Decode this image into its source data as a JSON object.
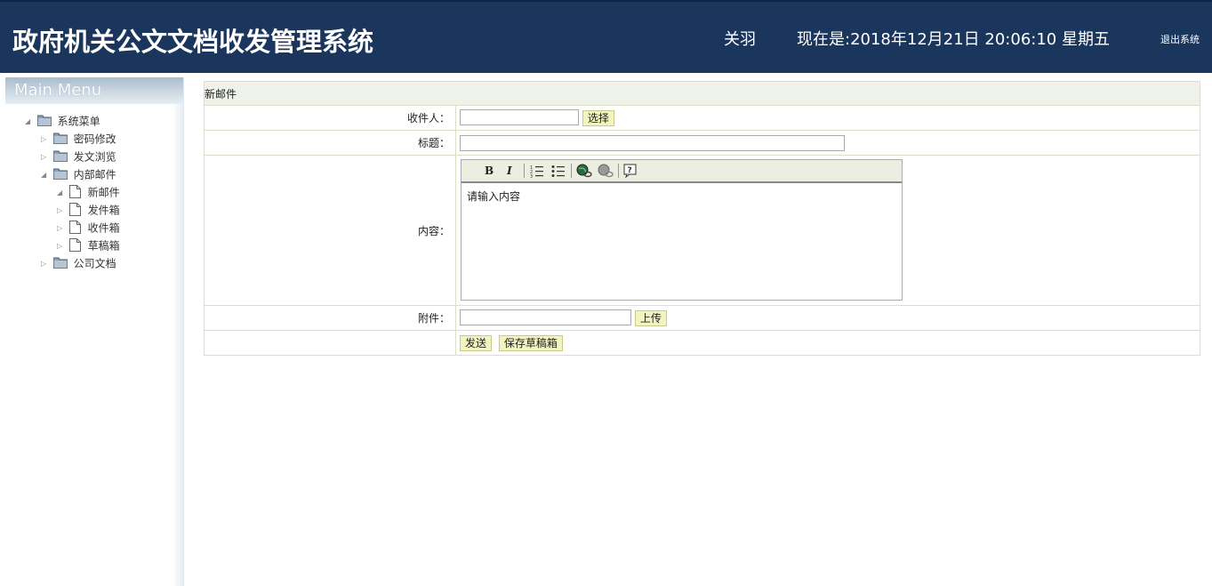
{
  "header": {
    "title": "政府机关公文文档收发管理系统",
    "user": "关羽",
    "clock": "现在是:2018年12月21日 20:06:10 星期五",
    "logout": "退出系统"
  },
  "sidebar": {
    "heading": "Main Menu",
    "tree": {
      "root": "系统菜单",
      "password": "密码修改",
      "browse": "发文浏览",
      "mail": "内部邮件",
      "new_mail": "新邮件",
      "outbox": "发件箱",
      "inbox": "收件箱",
      "drafts": "草稿箱",
      "company_docs": "公司文档"
    }
  },
  "form": {
    "title": "新邮件",
    "recipient_label": "收件人：",
    "recipient_value": "",
    "choose_button": "选择",
    "subject_label": "标题：",
    "subject_value": "",
    "content_label": "内容：",
    "content_placeholder": "请输入内容",
    "attachment_label": "附件：",
    "attachment_value": "",
    "upload_button": "上传",
    "send_button": "发送",
    "save_draft_button": "保存草稿箱"
  },
  "toolbar": {
    "bold": "B",
    "italic": "I"
  },
  "colors": {
    "header_bg": "#1b365d",
    "button_bg": "#f2f5c0",
    "title_row_bg": "#eef2e8"
  }
}
